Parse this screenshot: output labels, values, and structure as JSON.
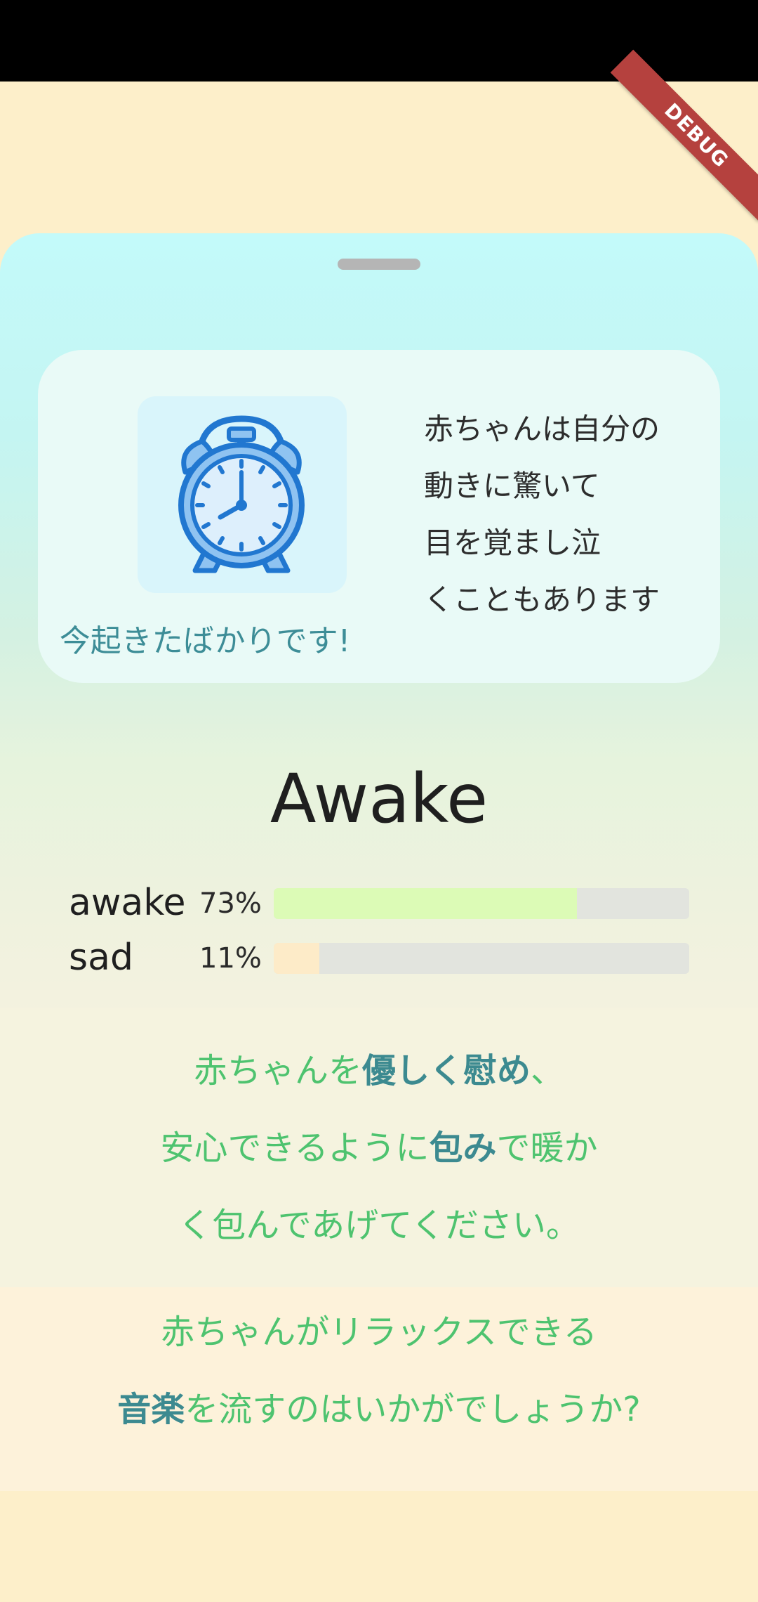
{
  "debug_banner": "DEBUG",
  "info_card": {
    "caption": "今起きたばかりです!",
    "description_lines": [
      "赤ちゃんは自分の",
      "動きに驚いて",
      "目を覚まし泣",
      "くこともあります"
    ],
    "icon": "alarm-clock-icon"
  },
  "state": {
    "title": "Awake"
  },
  "emotions": [
    {
      "label": "awake",
      "percent_text": "73%",
      "value": 0.73,
      "color": "#dcfbb6"
    },
    {
      "label": "sad",
      "percent_text": "11%",
      "value": 0.11,
      "color": "#fdebc8"
    }
  ],
  "advice": {
    "line1": {
      "pre": "赤ちゃんを",
      "bold": "優しく慰め",
      "post": "、"
    },
    "line2": {
      "pre": "安心できるように",
      "bold": "包み",
      "post": "で暖か"
    },
    "line3": {
      "text": "く包んであげてください。"
    }
  },
  "music": {
    "line1": {
      "text": "赤ちゃんがリラックスできる"
    },
    "line2": {
      "bold": "音楽",
      "post": "を流すのはいかがでしょうか?"
    }
  },
  "colors": {
    "accent_green": "#4ec36f",
    "accent_teal": "#3c8a90",
    "background": "#fdefca"
  }
}
